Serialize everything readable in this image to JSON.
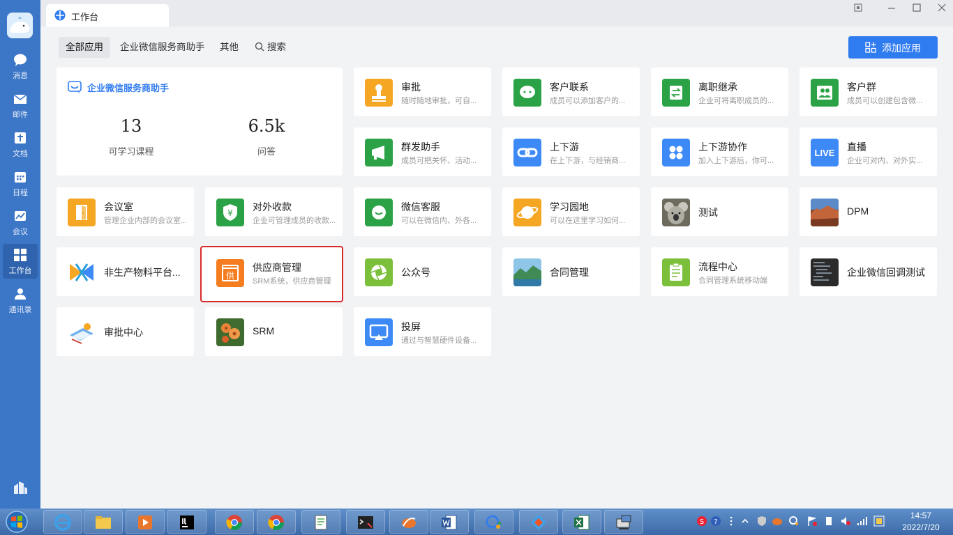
{
  "sidebar": {
    "items": [
      {
        "label": "消息",
        "icon": "chat-bubble-icon"
      },
      {
        "label": "邮件",
        "icon": "mail-icon"
      },
      {
        "label": "文档",
        "icon": "document-icon"
      },
      {
        "label": "日程",
        "icon": "calendar-icon"
      },
      {
        "label": "会议",
        "icon": "meeting-icon"
      },
      {
        "label": "工作台",
        "icon": "workbench-grid-icon",
        "active": true
      },
      {
        "label": "通讯录",
        "icon": "contacts-icon"
      }
    ]
  },
  "window": {
    "tab_title": "工作台"
  },
  "filters": {
    "all": "全部应用",
    "helper": "企业微信服务商助手",
    "other": "其他",
    "search": "搜索"
  },
  "add_button": "添加应用",
  "helper_card": {
    "title": "企业微信服务商助手",
    "stats": [
      {
        "value": "13",
        "label": "可学习课程"
      },
      {
        "value": "6.5k",
        "label": "问答"
      }
    ]
  },
  "apps": [
    {
      "name": "审批",
      "desc": "随时随地审批，可自..."
    },
    {
      "name": "客户联系",
      "desc": "成员可以添加客户的..."
    },
    {
      "name": "离职继承",
      "desc": "企业可将离职成员的..."
    },
    {
      "name": "客户群",
      "desc": "成员可以创建包含微..."
    },
    {
      "name": "群发助手",
      "desc": "成员可把关怀、活动..."
    },
    {
      "name": "上下游",
      "desc": "在上下游，与经销商..."
    },
    {
      "name": "上下游协作",
      "desc": "加入上下游后，你可..."
    },
    {
      "name": "直播",
      "desc": "企业可对内、对外实..."
    },
    {
      "name": "会议室",
      "desc": "管理企业内部的会议室..."
    },
    {
      "name": "对外收款",
      "desc": "企业可管理成员的收款..."
    },
    {
      "name": "微信客服",
      "desc": "可以在微信内、外各..."
    },
    {
      "name": "学习园地",
      "desc": "可以在这里学习如何..."
    },
    {
      "name": "测试",
      "desc": ""
    },
    {
      "name": "DPM",
      "desc": ""
    },
    {
      "name": "非生产物料平台...",
      "desc": ""
    },
    {
      "name": "供应商管理",
      "desc": "SRM系统，供应商管理"
    },
    {
      "name": "公众号",
      "desc": ""
    },
    {
      "name": "合同管理",
      "desc": ""
    },
    {
      "name": "流程中心",
      "desc": "合同管理系统移动端"
    },
    {
      "name": "企业微信回调测试",
      "desc": ""
    },
    {
      "name": "审批中心",
      "desc": ""
    },
    {
      "name": "SRM",
      "desc": ""
    },
    {
      "name": "投屏",
      "desc": "通过与智慧硬件设备..."
    }
  ],
  "icon_labels": {
    "live": "LIVE",
    "supplier": "供",
    "yen": "¥"
  },
  "clock": {
    "time": "14:57",
    "date": "2022/7/20"
  }
}
